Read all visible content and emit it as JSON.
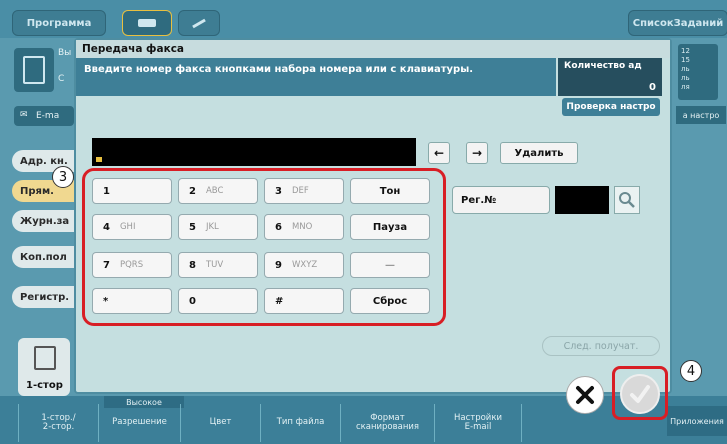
{
  "background": {
    "top_tabs": [
      "Программа",
      "СписокЗаданий"
    ],
    "left_buttons": [
      "Адр. кн.",
      "Прям.",
      "Журн.за",
      "Коп.пол",
      "Регистр."
    ],
    "left_partial_labels": [
      "Вы",
      "С",
      "E-ma"
    ],
    "right_partial": [
      "12",
      "15",
      "ль",
      "ль",
      "ля",
      "а настро"
    ],
    "thumb_label": "1-стор",
    "quality_label": "Высокое",
    "bottom_tabs": [
      "1-стор./\n2-стор.",
      "Разрешение",
      "Цвет",
      "Тип файла",
      "Формат\nсканирования",
      "Настройки\nE-mail"
    ],
    "right_tab": "Приложения"
  },
  "dialog": {
    "title": "Передача факса",
    "message": "Введите номер факса кнопками набора номера или с клавиатуры.",
    "count_label": "Количество ад",
    "count_value": "0",
    "check_settings": "Проверка настро",
    "delete_label": "Удалить",
    "arrow_left": "←",
    "arrow_right": "→",
    "keys": [
      {
        "main": "1",
        "sub": ""
      },
      {
        "main": "2",
        "sub": "ABC"
      },
      {
        "main": "3",
        "sub": "DEF"
      },
      {
        "main": "Тон",
        "sub": ""
      },
      {
        "main": "4",
        "sub": "GHI"
      },
      {
        "main": "5",
        "sub": "JKL"
      },
      {
        "main": "6",
        "sub": "MNO"
      },
      {
        "main": "Пауза",
        "sub": ""
      },
      {
        "main": "7",
        "sub": "PQRS"
      },
      {
        "main": "8",
        "sub": "TUV"
      },
      {
        "main": "9",
        "sub": "WXYZ"
      },
      {
        "main": "—",
        "sub": ""
      },
      {
        "main": "*",
        "sub": ""
      },
      {
        "main": "0",
        "sub": ""
      },
      {
        "main": "#",
        "sub": ""
      },
      {
        "main": "Сброс",
        "sub": ""
      }
    ],
    "reg_label": "Рег.№",
    "next_recipient": "След. получат."
  },
  "callouts": {
    "step3": "3",
    "step4": "4"
  },
  "colors": {
    "highlight": "#d81e25",
    "panel": "#c5dfe0",
    "header": "#3e7f97"
  }
}
